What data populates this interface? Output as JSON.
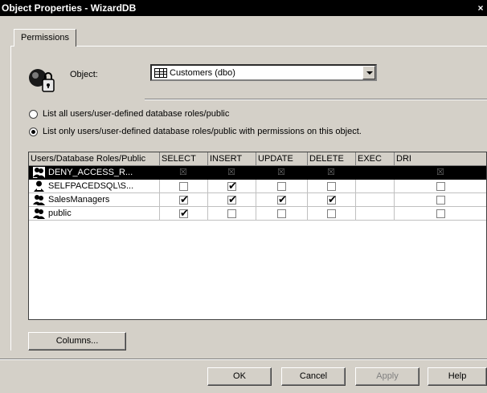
{
  "window": {
    "title": "Object Properties - WizardDB",
    "close_glyph": "×"
  },
  "tabs": [
    {
      "label": "Permissions"
    }
  ],
  "object": {
    "label": "Object:",
    "value": "Customers (dbo)"
  },
  "options": [
    {
      "label": "List all users/user-defined database roles/public",
      "checked": false
    },
    {
      "label": "List only users/user-defined database roles/public with permissions on this object.",
      "checked": true
    }
  ],
  "grid": {
    "columns": [
      "Users/Database Roles/Public",
      "SELECT",
      "INSERT",
      "UPDATE",
      "DELETE",
      "EXEC",
      "DRI"
    ],
    "rows": [
      {
        "name": "DENY_ACCESS_R...",
        "icon": "role-icon",
        "selected": true,
        "perms": {
          "select": "deny",
          "insert": "deny",
          "update": "deny",
          "delete": "deny",
          "exec": "none",
          "dri": "deny"
        }
      },
      {
        "name": "SELFPACEDSQL\\S...",
        "icon": "user-icon",
        "selected": false,
        "perms": {
          "select": false,
          "insert": true,
          "update": false,
          "delete": false,
          "exec": "none",
          "dri": false
        }
      },
      {
        "name": "SalesManagers",
        "icon": "role-icon",
        "selected": false,
        "perms": {
          "select": true,
          "insert": true,
          "update": true,
          "delete": true,
          "exec": "none",
          "dri": false
        }
      },
      {
        "name": "public",
        "icon": "role-icon",
        "selected": false,
        "perms": {
          "select": true,
          "insert": false,
          "update": false,
          "delete": false,
          "exec": "none",
          "dri": false
        }
      }
    ]
  },
  "buttons": {
    "columns": "Columns...",
    "ok": "OK",
    "cancel": "Cancel",
    "apply": "Apply",
    "help": "Help"
  },
  "colors": {
    "selection": "#000000",
    "face": "#d4d0c8",
    "titlebar": "#000000"
  }
}
